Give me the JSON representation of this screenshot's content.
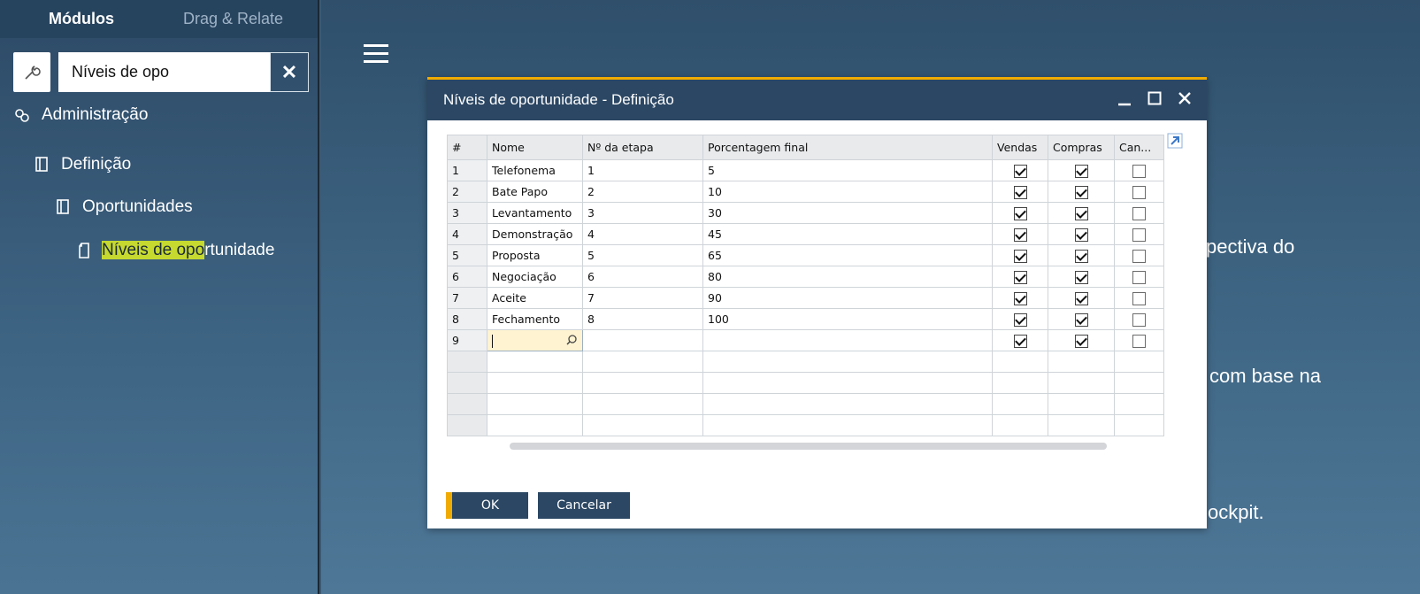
{
  "sidebar": {
    "tabs": [
      {
        "label": "Módulos"
      },
      {
        "label": "Drag & Relate"
      }
    ],
    "search": {
      "value": "Níveis de opo"
    },
    "clear_label": "✕",
    "tree": {
      "administracao": "Administração",
      "definicao": "Definição",
      "oportunidades": "Oportunidades",
      "niveis_hl": "Níveis de opo",
      "niveis_rest": "rtunidade"
    }
  },
  "background_text": [
    "pectiva do",
    "com base na",
    "ockpit."
  ],
  "dialog": {
    "title": "Níveis de oportunidade - Definição",
    "columns": [
      "#",
      "Nome",
      "Nº da etapa",
      "Porcentagem final",
      "Vendas",
      "Compras",
      "Can..."
    ],
    "rows": [
      {
        "n": "1",
        "nome": "Telefonema",
        "etapa": "1",
        "pct": "5",
        "vendas": true,
        "compras": true,
        "can": false
      },
      {
        "n": "2",
        "nome": "Bate Papo",
        "etapa": "2",
        "pct": "10",
        "vendas": true,
        "compras": true,
        "can": false
      },
      {
        "n": "3",
        "nome": "Levantamento",
        "etapa": "3",
        "pct": "30",
        "vendas": true,
        "compras": true,
        "can": false
      },
      {
        "n": "4",
        "nome": "Demonstração",
        "etapa": "4",
        "pct": "45",
        "vendas": true,
        "compras": true,
        "can": false
      },
      {
        "n": "5",
        "nome": "Proposta",
        "etapa": "5",
        "pct": "65",
        "vendas": true,
        "compras": true,
        "can": false
      },
      {
        "n": "6",
        "nome": "Negociação",
        "etapa": "6",
        "pct": "80",
        "vendas": true,
        "compras": true,
        "can": false
      },
      {
        "n": "7",
        "nome": "Aceite",
        "etapa": "7",
        "pct": "90",
        "vendas": true,
        "compras": true,
        "can": false
      },
      {
        "n": "8",
        "nome": "Fechamento",
        "etapa": "8",
        "pct": "100",
        "vendas": true,
        "compras": true,
        "can": false
      },
      {
        "n": "9",
        "nome": "",
        "etapa": "",
        "pct": "",
        "vendas": true,
        "compras": true,
        "can": false
      }
    ],
    "ok_label": "OK",
    "cancel_label": "Cancelar"
  },
  "colors": {
    "accent": "#f0ab00",
    "header": "#2b4764",
    "highlight": "#c6d92f"
  }
}
